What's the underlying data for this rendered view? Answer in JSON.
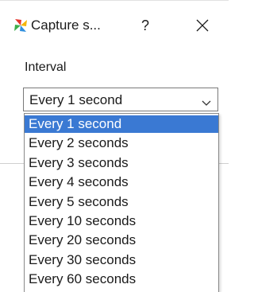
{
  "window": {
    "title": "Capture s...",
    "help_glyph": "?",
    "app_icon": "colorful-pinwheel-icon",
    "close_icon": "close-icon"
  },
  "form": {
    "interval_label": "Interval",
    "interval_value": "Every 1 second"
  },
  "dropdown": {
    "selected_index": 0,
    "options": [
      "Every 1 second",
      "Every 2 seconds",
      "Every 3 seconds",
      "Every 4 seconds",
      "Every 5 seconds",
      "Every 10 seconds",
      "Every 20 seconds",
      "Every 30 seconds",
      "Every 60 seconds"
    ]
  },
  "colors": {
    "selection": "#3a79d3",
    "selection_text": "#ffffff"
  }
}
